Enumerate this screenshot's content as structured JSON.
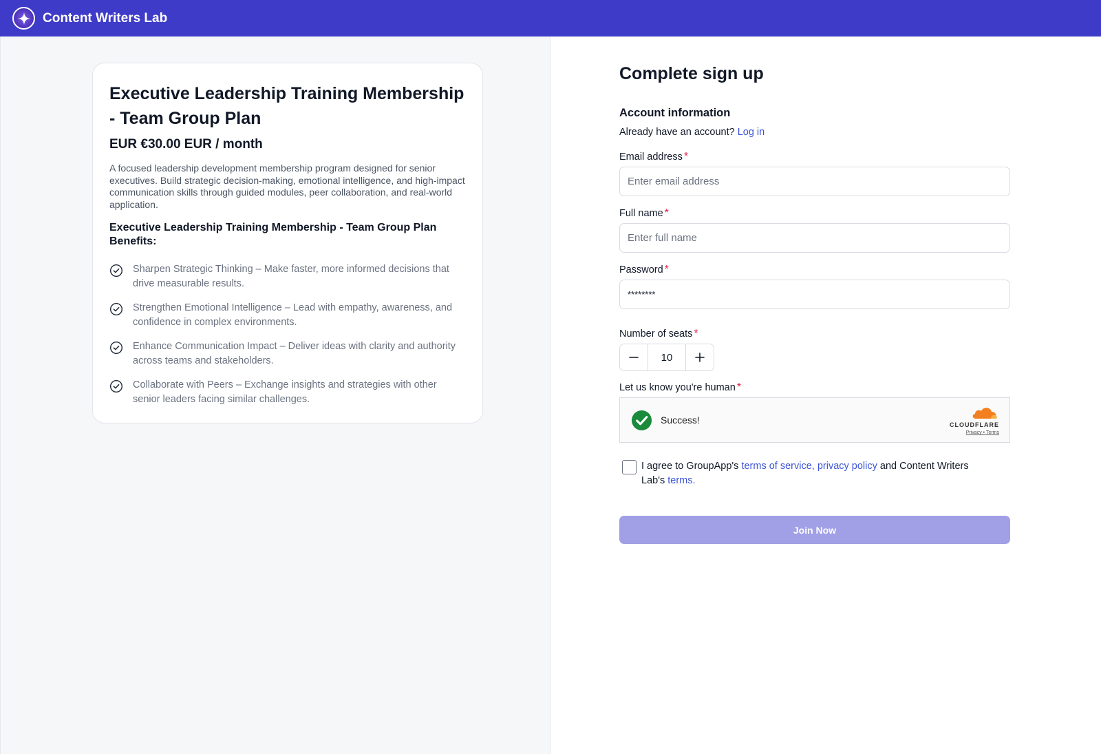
{
  "header": {
    "brand": "Content Writers Lab",
    "logo_icon": "sparkle-logo-icon",
    "bg_color": "#3e3bc8"
  },
  "plan": {
    "title": "Executive Leadership Training Membership - Team Group Plan",
    "price": "EUR €30.00 EUR / month",
    "description": "A focused leadership development membership program designed for senior executives. Build strategic decision-making, emotional intelligence, and high-impact communication skills through guided modules, peer collaboration, and real-world application.",
    "benefits_heading": "Executive Leadership Training Membership - Team Group Plan Benefits:",
    "benefits": [
      {
        "text": "Sharpen Strategic Thinking – Make faster, more informed decisions that drive measurable results.",
        "icon": "check-circle-icon"
      },
      {
        "text": "Strengthen Emotional Intelligence – Lead with empathy, awareness, and confidence in complex environments.",
        "icon": "check-circle-icon"
      },
      {
        "text": "Enhance Communication Impact – Deliver ideas with clarity and authority across teams and stakeholders.",
        "icon": "check-circle-icon"
      },
      {
        "text": "Collaborate with Peers – Exchange insights and strategies with other senior leaders facing similar challenges.",
        "icon": "check-circle-icon"
      }
    ]
  },
  "form": {
    "title": "Complete sign up",
    "section_title": "Account information",
    "login_prompt": "Already have an account?",
    "login_link": "Log in",
    "required_mark": "*",
    "email": {
      "label": "Email address",
      "placeholder": "Enter email address",
      "value": ""
    },
    "full_name": {
      "label": "Full name",
      "placeholder": "Enter full name",
      "value": ""
    },
    "password": {
      "label": "Password",
      "value": "********"
    },
    "seats": {
      "label": "Number of seats",
      "value": "10",
      "minus_icon": "minus-icon",
      "plus_icon": "plus-icon"
    },
    "captcha": {
      "label": "Let us know you're human",
      "status": "Success!",
      "provider": "CLOUDFLARE",
      "privacy": "Privacy",
      "separator": "•",
      "terms": "Terms"
    },
    "agree": {
      "prefix": "I agree to GroupApp's",
      "terms_link": "terms of service,",
      "privacy_link": "privacy policy",
      "middle": "and Content Writers Lab's",
      "lab_terms_link": "terms.",
      "checked": false
    },
    "submit_label": "Join Now",
    "submit_color": "#a19fe6",
    "link_color": "#3b55d9"
  }
}
